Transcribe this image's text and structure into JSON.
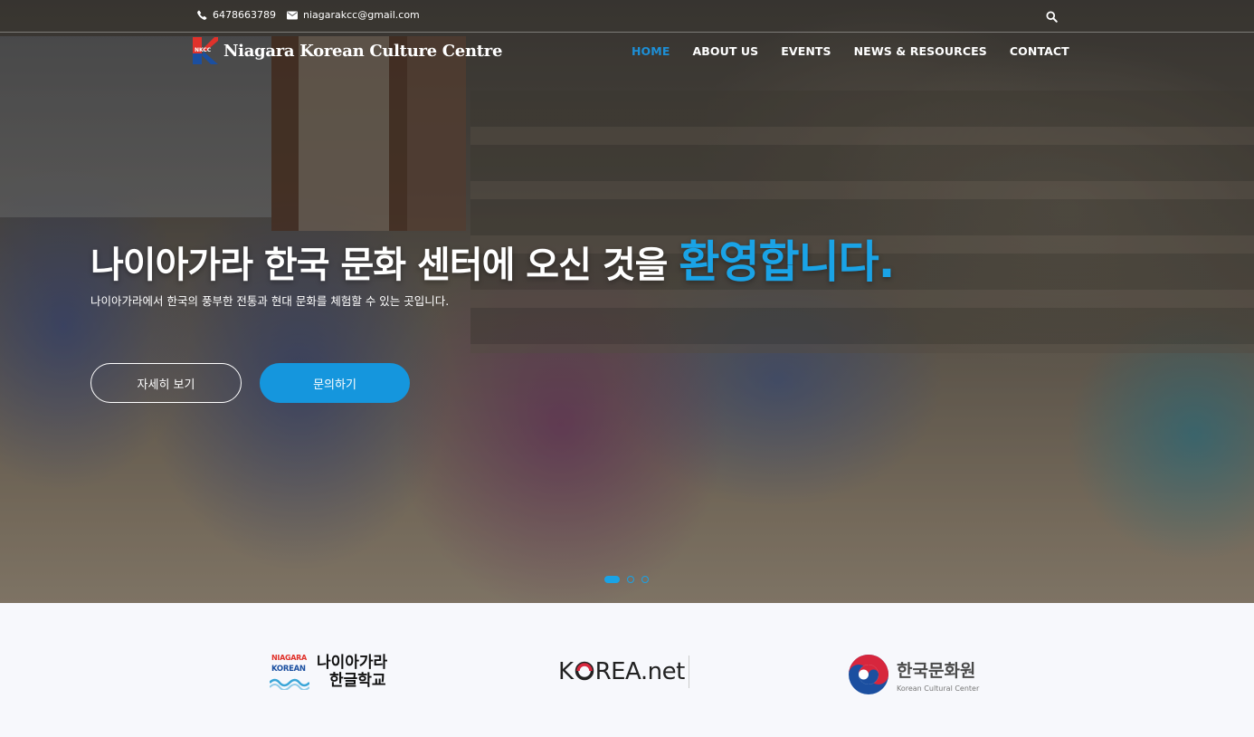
{
  "topbar": {
    "phone": "6478663789",
    "email": "niagarakcc@gmail.com"
  },
  "brand": {
    "logo_abbr": "NKCC",
    "name": "Niagara Korean Culture Centre"
  },
  "nav": {
    "items": [
      {
        "label": "HOME",
        "active": true
      },
      {
        "label": "ABOUT US",
        "active": false
      },
      {
        "label": "EVENTS",
        "active": false
      },
      {
        "label": "NEWS & RESOURCES",
        "active": false
      },
      {
        "label": "CONTACT",
        "active": false
      }
    ]
  },
  "hero": {
    "headline_main": "나이아가라 한국 문화 센터에 오신 것을 ",
    "headline_highlight": "환영합니다.",
    "subtitle": "나이아가라에서 한국의 풍부한 전통과 현대 문화를 체험할 수 있는 곳입니다.",
    "primary_button": "자세히 보기",
    "secondary_button": "문의하기",
    "slides_total": 3,
    "slide_active": 1
  },
  "partners": {
    "hangul_school": {
      "badge_top": "NIAGARA",
      "badge_bottom": "KOREAN",
      "name_line1": "나이아가라",
      "name_line2": "한글학교"
    },
    "korea_net": {
      "name_k": "K",
      "name_rea": "REA",
      "name_net": ".net"
    },
    "kcc": {
      "name_ko": "한국문화원",
      "name_en": "Korean Cultural Center"
    }
  },
  "colors": {
    "accent": "#1aa3e6",
    "nav_active": "#1d8fd6",
    "button_fill": "#1596dd",
    "logo_red": "#e0322b",
    "logo_blue": "#1b4fa0"
  }
}
